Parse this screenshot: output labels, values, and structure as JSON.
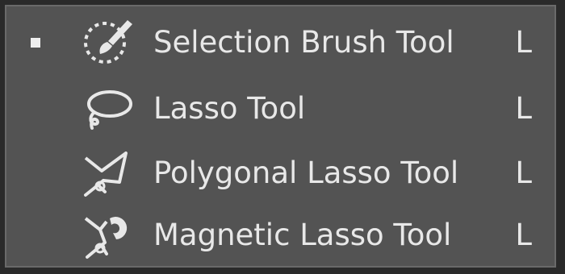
{
  "menu": {
    "items": [
      {
        "label": "Selection Brush Tool",
        "shortcut": "L",
        "icon": "selection-brush-icon",
        "selected": true
      },
      {
        "label": "Lasso Tool",
        "shortcut": "L",
        "icon": "lasso-icon",
        "selected": false
      },
      {
        "label": "Polygonal Lasso Tool",
        "shortcut": "L",
        "icon": "polygonal-lasso-icon",
        "selected": false
      },
      {
        "label": "Magnetic Lasso Tool",
        "shortcut": "L",
        "icon": "magnetic-lasso-icon",
        "selected": false
      }
    ]
  },
  "colors": {
    "panel_background": "#535353",
    "text": "#e8e8e8",
    "icon": "#e8e8e8"
  }
}
